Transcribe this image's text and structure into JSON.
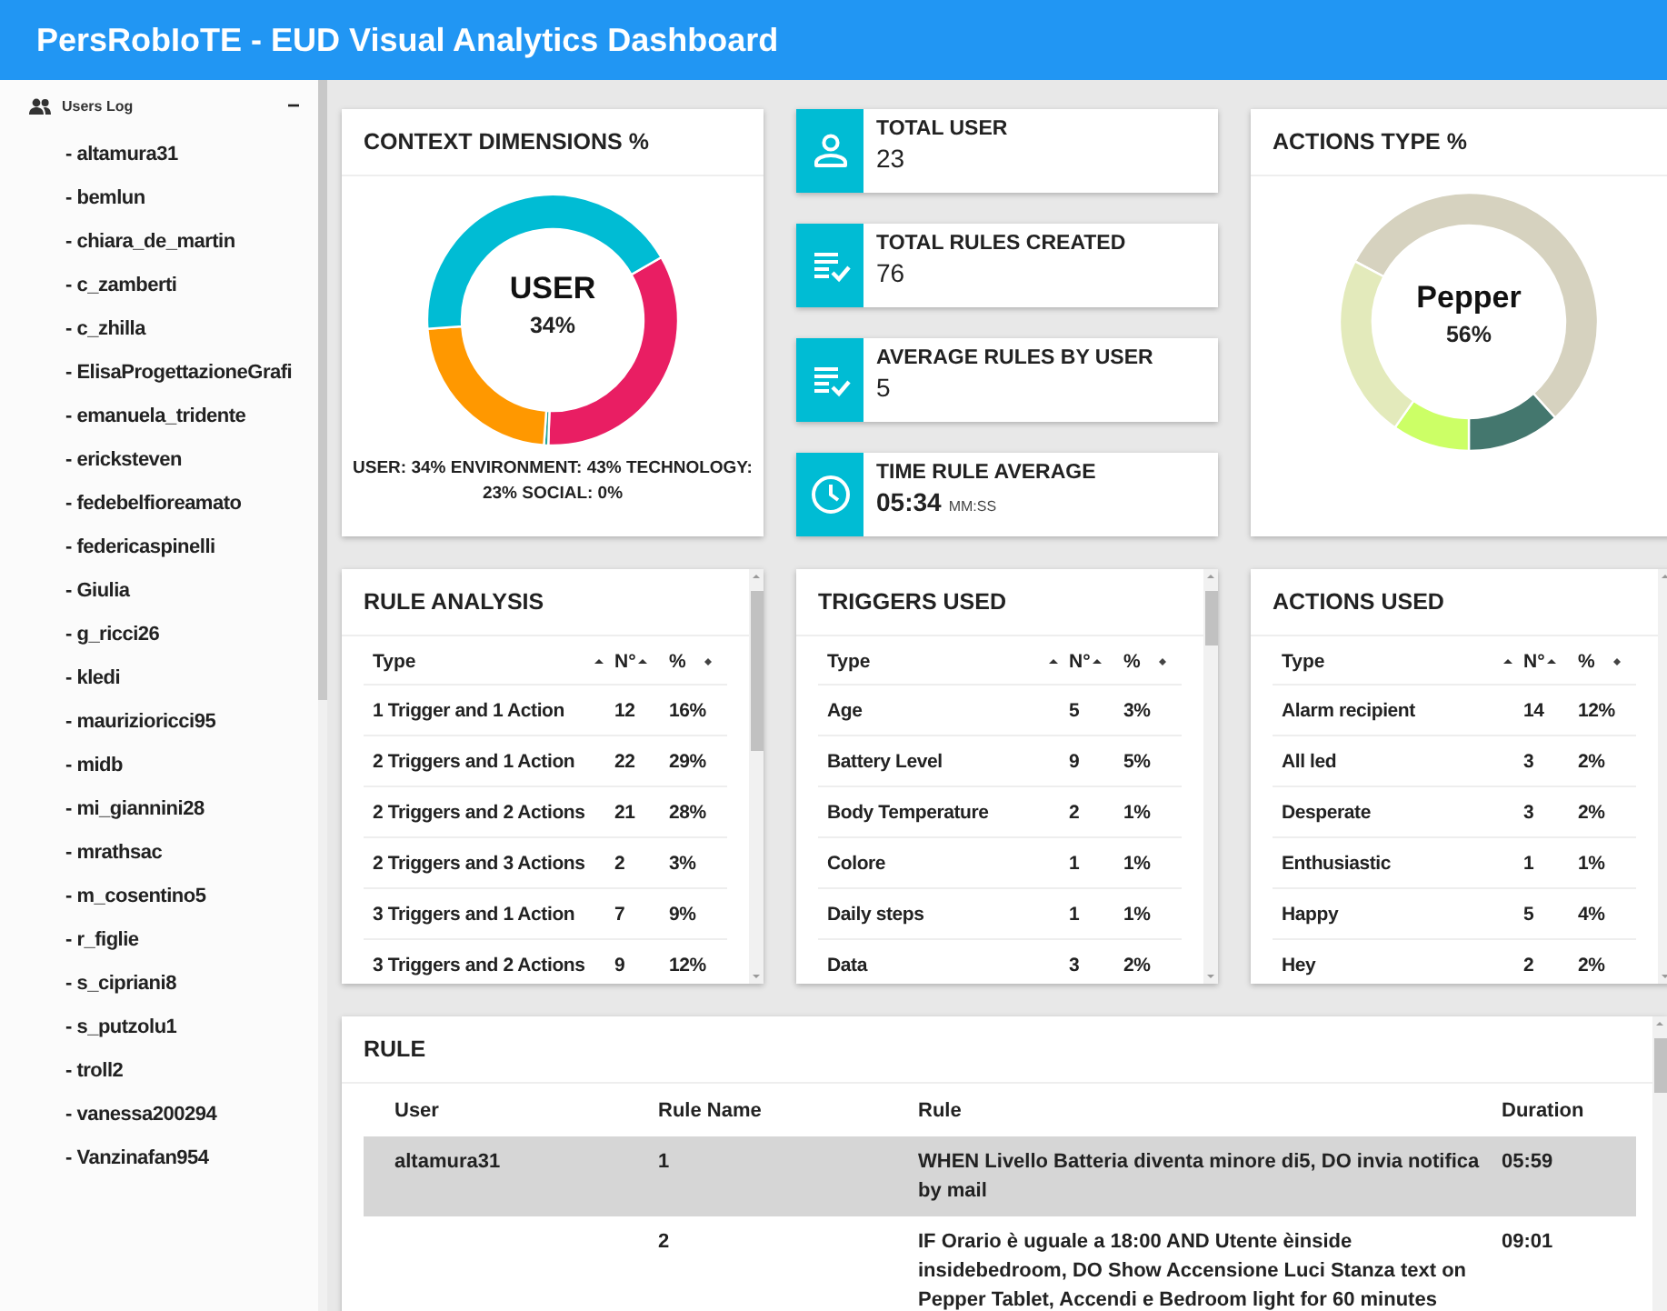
{
  "header": {
    "title": "PersRobIoTE - EUD Visual Analytics Dashboard"
  },
  "sidebar": {
    "title": "Users Log",
    "toggle": "−",
    "items": [
      "- altamura31",
      "- bemlun",
      "- chiara_de_martin",
      "- c_zamberti",
      "- c_zhilla",
      "- ElisaProgettazioneGrafi",
      "- emanuela_tridente",
      "- ericksteven",
      "- fedebelfioreamato",
      "- federicaspinelli",
      "- Giulia",
      "- g_ricci26",
      "- kledi",
      "- maurizioricci95",
      "- midb",
      "- mi_giannini28",
      "- mrathsac",
      "- m_cosentino5",
      "- r_figlie",
      "- s_cipriani8",
      "- s_putzolu1",
      "- troll2",
      "- vanessa200294",
      "- Vanzinafan954"
    ]
  },
  "context_dimensions": {
    "title": "CONTEXT DIMENSIONS %",
    "center_label": "USER",
    "center_value": "34%",
    "legend": "USER: 34% ENVIRONMENT: 43% TECHNOLOGY: 23% SOCIAL: 0%"
  },
  "stats": [
    {
      "kind": "user",
      "title": "TOTAL USER",
      "value": "23"
    },
    {
      "kind": "rules",
      "title": "TOTAL RULES CREATED",
      "value": "76"
    },
    {
      "kind": "rules",
      "title": "AVERAGE RULES BY USER",
      "value": "5"
    },
    {
      "kind": "time",
      "title": "TIME RULE AVERAGE",
      "value": "05:34",
      "unit": "MM:SS"
    }
  ],
  "actions_type": {
    "title": "ACTIONS TYPE %",
    "center_label": "Pepper",
    "center_value": "56%"
  },
  "tables": [
    {
      "title": "RULE ANALYSIS",
      "columns": [
        {
          "label": "Type",
          "sorted": true
        },
        {
          "label": "N°",
          "sorted": true
        },
        {
          "label": "%",
          "sorted": false
        }
      ],
      "rows": [
        [
          "1 Trigger and 1 Action",
          "12",
          "16%"
        ],
        [
          "2 Triggers and 1 Action",
          "22",
          "29%"
        ],
        [
          "2 Triggers and 2 Actions",
          "21",
          "28%"
        ],
        [
          "2 Triggers and 3 Actions",
          "2",
          "3%"
        ],
        [
          "3 Triggers and 1 Action",
          "7",
          "9%"
        ],
        [
          "3 Triggers and 2 Actions",
          "9",
          "12%"
        ]
      ]
    },
    {
      "title": "TRIGGERS USED",
      "columns": [
        {
          "label": "Type",
          "sorted": true
        },
        {
          "label": "N°",
          "sorted": true
        },
        {
          "label": "%",
          "sorted": false
        }
      ],
      "rows": [
        [
          "Age",
          "5",
          "3%"
        ],
        [
          "Battery Level",
          "9",
          "5%"
        ],
        [
          "Body Temperature",
          "2",
          "1%"
        ],
        [
          "Colore",
          "1",
          "1%"
        ],
        [
          "Daily steps",
          "1",
          "1%"
        ],
        [
          "Data",
          "3",
          "2%"
        ]
      ]
    },
    {
      "title": "ACTIONS USED",
      "columns": [
        {
          "label": "Type",
          "sorted": true
        },
        {
          "label": "N°",
          "sorted": true
        },
        {
          "label": "%",
          "sorted": false
        }
      ],
      "rows": [
        [
          "Alarm recipient",
          "14",
          "12%"
        ],
        [
          "All led",
          "3",
          "2%"
        ],
        [
          "Desperate",
          "3",
          "2%"
        ],
        [
          "Enthusiastic",
          "1",
          "1%"
        ],
        [
          "Happy",
          "5",
          "4%"
        ],
        [
          "Hey",
          "2",
          "2%"
        ]
      ]
    }
  ],
  "rule": {
    "title": "RULE",
    "columns": [
      "User",
      "Rule Name",
      "Rule",
      "Duration"
    ],
    "rows": [
      {
        "user": "altamura31",
        "name": "1",
        "rule": "WHEN Livello Batteria diventa minore di5, DO invia notifica by mail",
        "duration": "05:59",
        "selected": true
      },
      {
        "name": "2",
        "rule": "IF Orario è uguale a 18:00 AND Utente èinside insidebedroom, DO Show Accensione Luci Stanza text on Pepper Tablet, Accendi e Bedroom light for 60 minutes",
        "duration": "09:01",
        "selected": false
      }
    ]
  }
}
